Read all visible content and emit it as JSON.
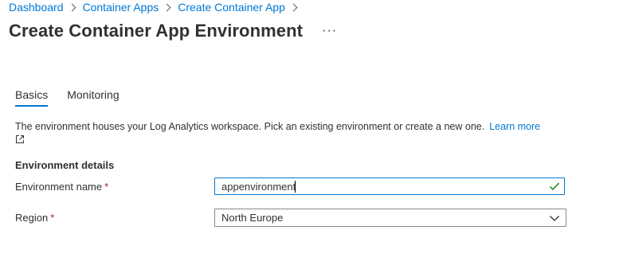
{
  "breadcrumb": {
    "items": [
      "Dashboard",
      "Container Apps",
      "Create Container App"
    ]
  },
  "header": {
    "title": "Create Container App Environment",
    "more_label": "···"
  },
  "tabs": [
    {
      "label": "Basics",
      "active": true
    },
    {
      "label": "Monitoring",
      "active": false
    }
  ],
  "description": {
    "text": "The environment houses your Log Analytics workspace. Pick an existing environment or create a new one.",
    "link_label": "Learn more",
    "link_icon": "external-link-icon"
  },
  "section": {
    "heading": "Environment details"
  },
  "fields": {
    "environment_name": {
      "label": "Environment name",
      "required_mark": "*",
      "value": "appenvironment",
      "status_icon": "checkmark-icon"
    },
    "region": {
      "label": "Region",
      "required_mark": "*",
      "value": "North Europe",
      "icon": "chevron-down-icon"
    }
  },
  "colors": {
    "accent": "#0078d4",
    "text": "#323130",
    "required": "#a4262c",
    "valid": "#107c10"
  }
}
